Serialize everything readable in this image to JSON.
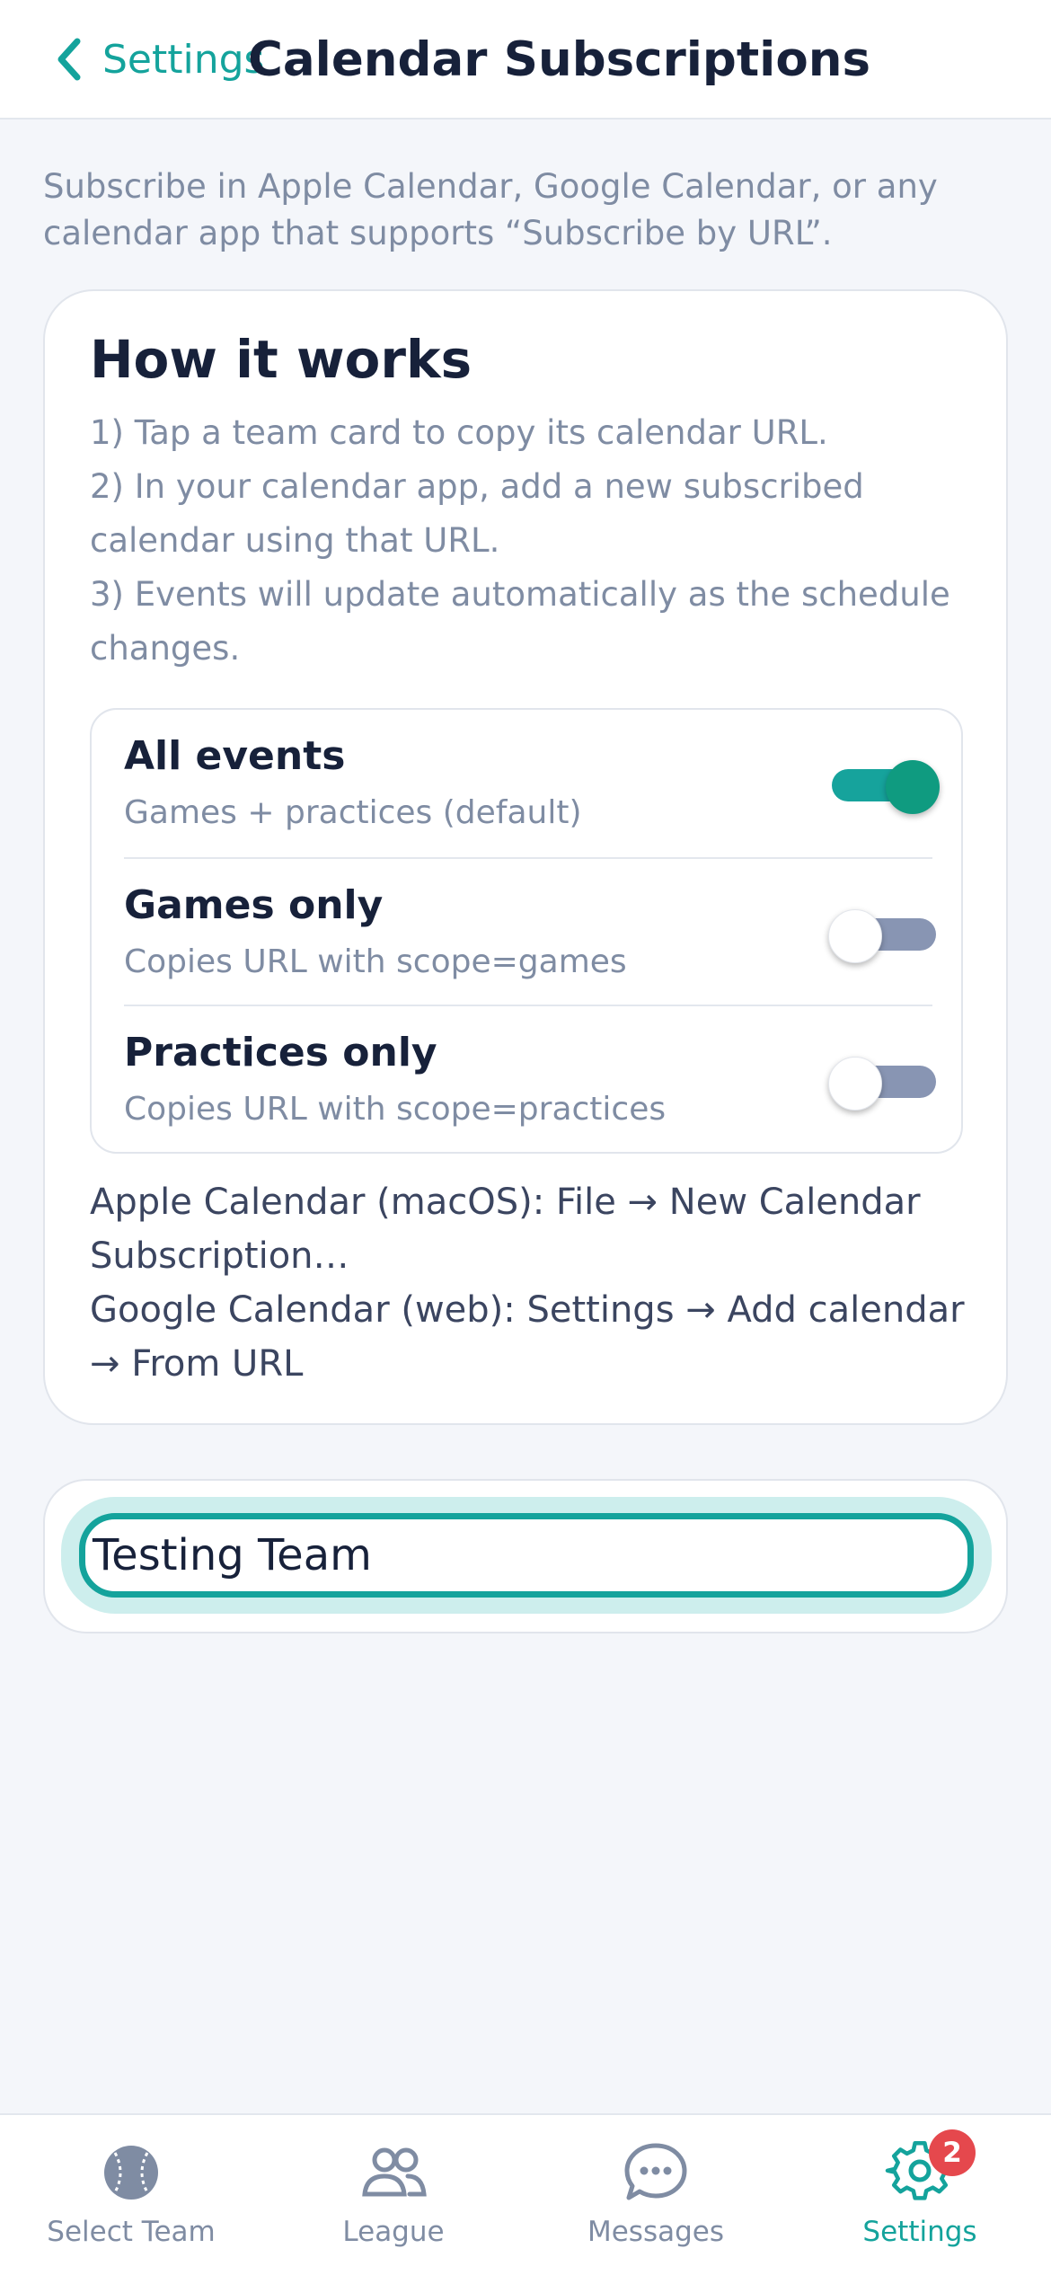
{
  "header": {
    "back_label": "Settings",
    "title": "Calendar Subscriptions"
  },
  "intro": "Subscribe in Apple Calendar, Google Calendar, or any calendar app that supports “Subscribe by URL”.",
  "how_it_works": {
    "heading": "How it works",
    "steps": [
      "1) Tap a team card to copy its calendar URL.",
      "2) In your calendar app, add a new subscribed calendar using that URL.",
      "3) Events will update automatically as the schedule changes."
    ],
    "options": [
      {
        "name": "All events",
        "desc": "Games + practices (default)",
        "on": true
      },
      {
        "name": "Games only",
        "desc": "Copies URL with scope=games",
        "on": false
      },
      {
        "name": "Practices only",
        "desc": "Copies URL with scope=practices",
        "on": false
      }
    ],
    "tips": [
      "Apple Calendar (macOS): File → New Calendar Subscription…",
      "Google Calendar (web): Settings → Add calendar → From URL"
    ]
  },
  "team_card": {
    "name": "Testing Team"
  },
  "tabbar": {
    "items": [
      {
        "label": "Select Team",
        "icon": "baseball-icon"
      },
      {
        "label": "League",
        "icon": "people-icon"
      },
      {
        "label": "Messages",
        "icon": "chat-bubble-icon"
      },
      {
        "label": "Settings",
        "icon": "gear-icon",
        "badge": "2"
      }
    ]
  },
  "colors": {
    "accent": "#14a39c",
    "toggle_on_knob": "#0f9b80",
    "toggle_off_track": "#8895b3",
    "badge": "#e5484d"
  }
}
